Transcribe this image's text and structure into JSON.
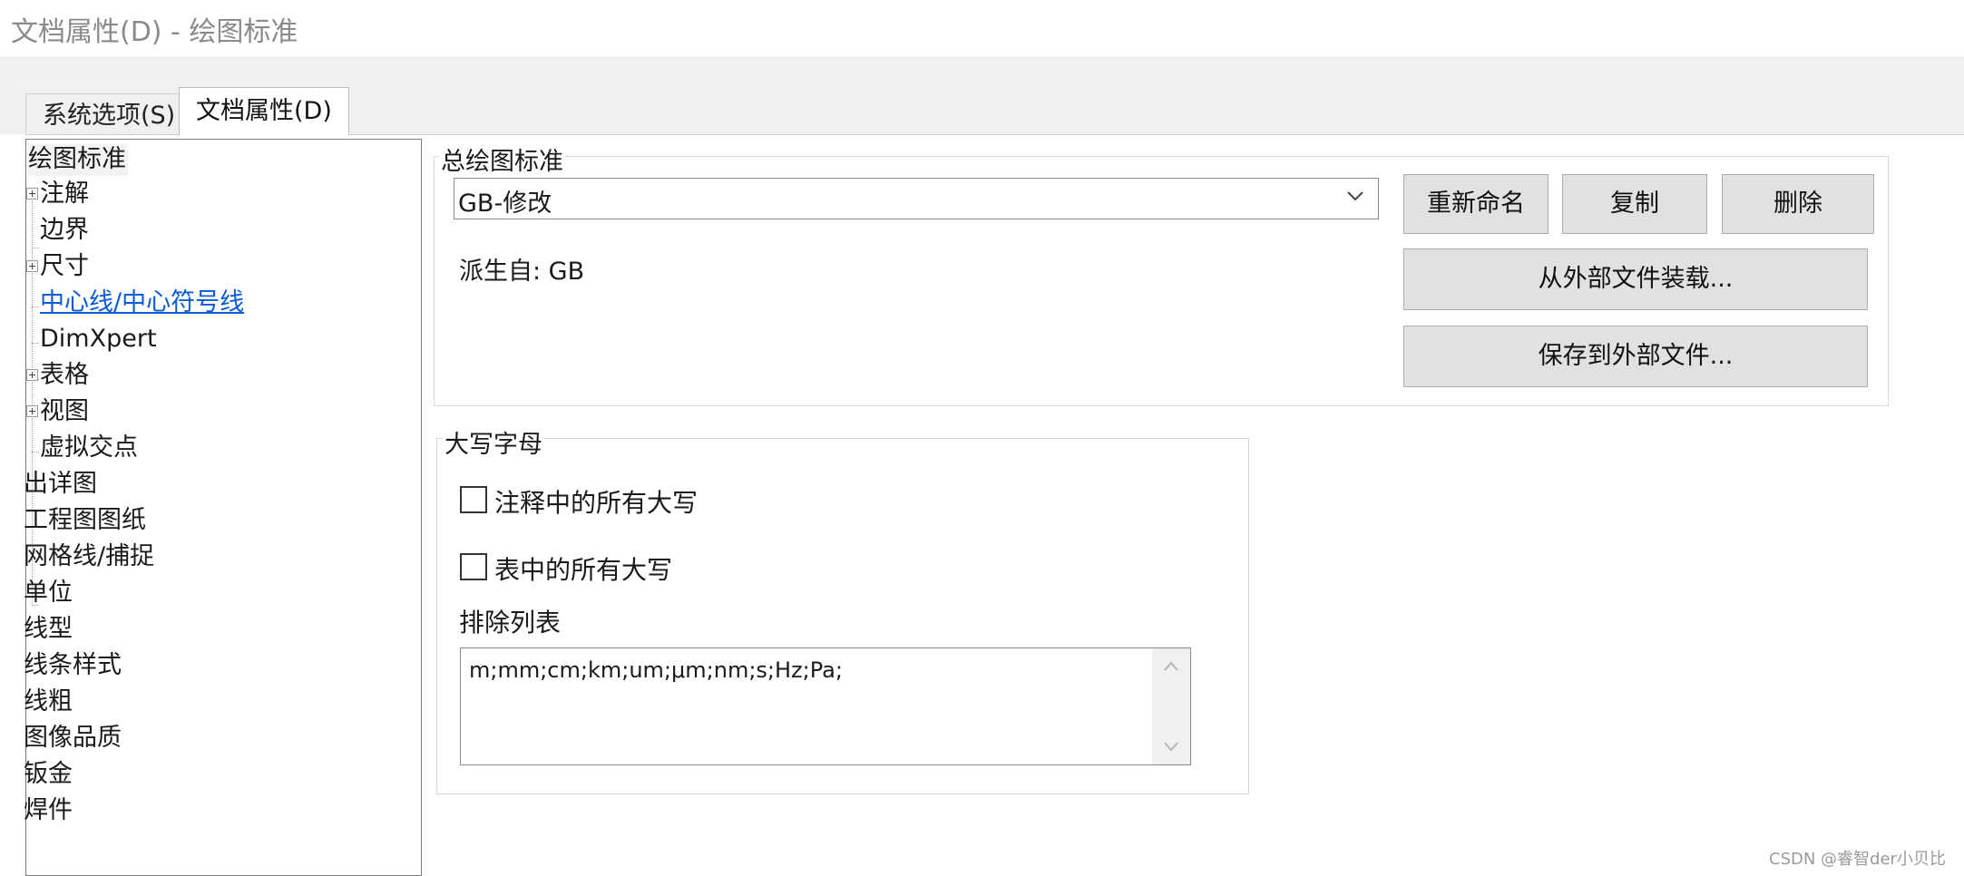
{
  "window": {
    "title": "文档属性(D) - 绘图标准"
  },
  "tabs": [
    {
      "label": "系统选项(S)",
      "active": false
    },
    {
      "label": "文档属性(D)",
      "active": true
    }
  ],
  "tree": {
    "items": [
      {
        "label": "绘图标准",
        "selected": true
      },
      {
        "label": "注解",
        "expandable": true
      },
      {
        "label": "边界"
      },
      {
        "label": "尺寸",
        "expandable": true
      },
      {
        "label": "中心线/中心符号线",
        "link": true
      },
      {
        "label": "DimXpert"
      },
      {
        "label": "表格",
        "expandable": true
      },
      {
        "label": "视图",
        "expandable": true
      },
      {
        "label": "虚拟交点"
      },
      {
        "label": "出详图"
      },
      {
        "label": "工程图图纸"
      },
      {
        "label": "网格线/捕捉"
      },
      {
        "label": "单位"
      },
      {
        "label": "线型"
      },
      {
        "label": "线条样式"
      },
      {
        "label": "线粗"
      },
      {
        "label": "图像品质"
      },
      {
        "label": "钣金"
      },
      {
        "label": "焊件"
      }
    ]
  },
  "overall_standard": {
    "group_label": "总绘图标准",
    "selected_value": "GB-修改",
    "derived_label": "派生自: GB",
    "buttons": {
      "rename": "重新命名",
      "copy": "复制",
      "delete": "删除",
      "load_external": "从外部文件装载...",
      "save_external": "保存到外部文件..."
    }
  },
  "uppercase": {
    "group_label": "大写字母",
    "all_caps_notes_label": "注释中的所有大写",
    "all_caps_notes_checked": false,
    "all_caps_tables_label": "表中的所有大写",
    "all_caps_tables_checked": false,
    "exclusion_list_label": "排除列表",
    "exclusion_list_value": "m;mm;cm;km;um;μm;nm;s;Hz;Pa;"
  },
  "watermark": "CSDN @睿智der小贝比"
}
